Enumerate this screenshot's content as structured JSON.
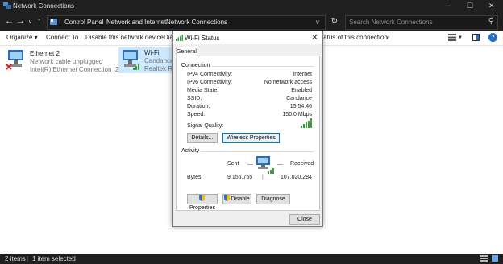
{
  "window": {
    "title": "Network Connections"
  },
  "address": {
    "crumbs": [
      "Control Panel",
      "Network and Internet",
      "Network Connections"
    ],
    "search_placeholder": "Search Network Connections"
  },
  "toolbar": {
    "organize": "Organize ▾",
    "connect_to": "Connect To",
    "disable_device": "Disable this network device",
    "diagnose_partial": "Dia",
    "status_partial": "tatus of this connection",
    "more": "»"
  },
  "connections": [
    {
      "name": "Ethernet 2",
      "status": "Network cable unplugged",
      "device": "Intel(R) Ethernet Connection I219-V"
    },
    {
      "name": "Wi-Fi",
      "status": "Candance",
      "device": "Realtek RTL"
    }
  ],
  "statusbar": {
    "items": "2 items",
    "selected": "1 item selected"
  },
  "dialog": {
    "title": "Wi-Fi Status",
    "tab": "General",
    "connection_header": "Connection",
    "rows": [
      {
        "label": "IPv4 Connectivity:",
        "value": "Internet"
      },
      {
        "label": "IPv6 Connectivity:",
        "value": "No network access"
      },
      {
        "label": "Media State:",
        "value": "Enabled"
      },
      {
        "label": "SSID:",
        "value": "Candance"
      },
      {
        "label": "Duration:",
        "value": "15:54:46"
      },
      {
        "label": "Speed:",
        "value": "150.0 Mbps"
      }
    ],
    "signal_label": "Signal Quality:",
    "signal_bars": 5,
    "details_btn": "Details...",
    "wireless_btn": "Wireless Properties",
    "activity_header": "Activity",
    "sent_label": "Sent",
    "received_label": "Received",
    "bytes_label": "Bytes:",
    "bytes_sent": "9,155,755",
    "bytes_received": "107,020,284",
    "properties_btn": "Properties",
    "disable_btn": "Disable",
    "diagnose_btn": "Diagnose",
    "close_btn": "Close"
  },
  "colors": {
    "dark_chrome": "#1f1f1f",
    "accent": "#0078d7",
    "signal_green": "#3aa13a"
  }
}
